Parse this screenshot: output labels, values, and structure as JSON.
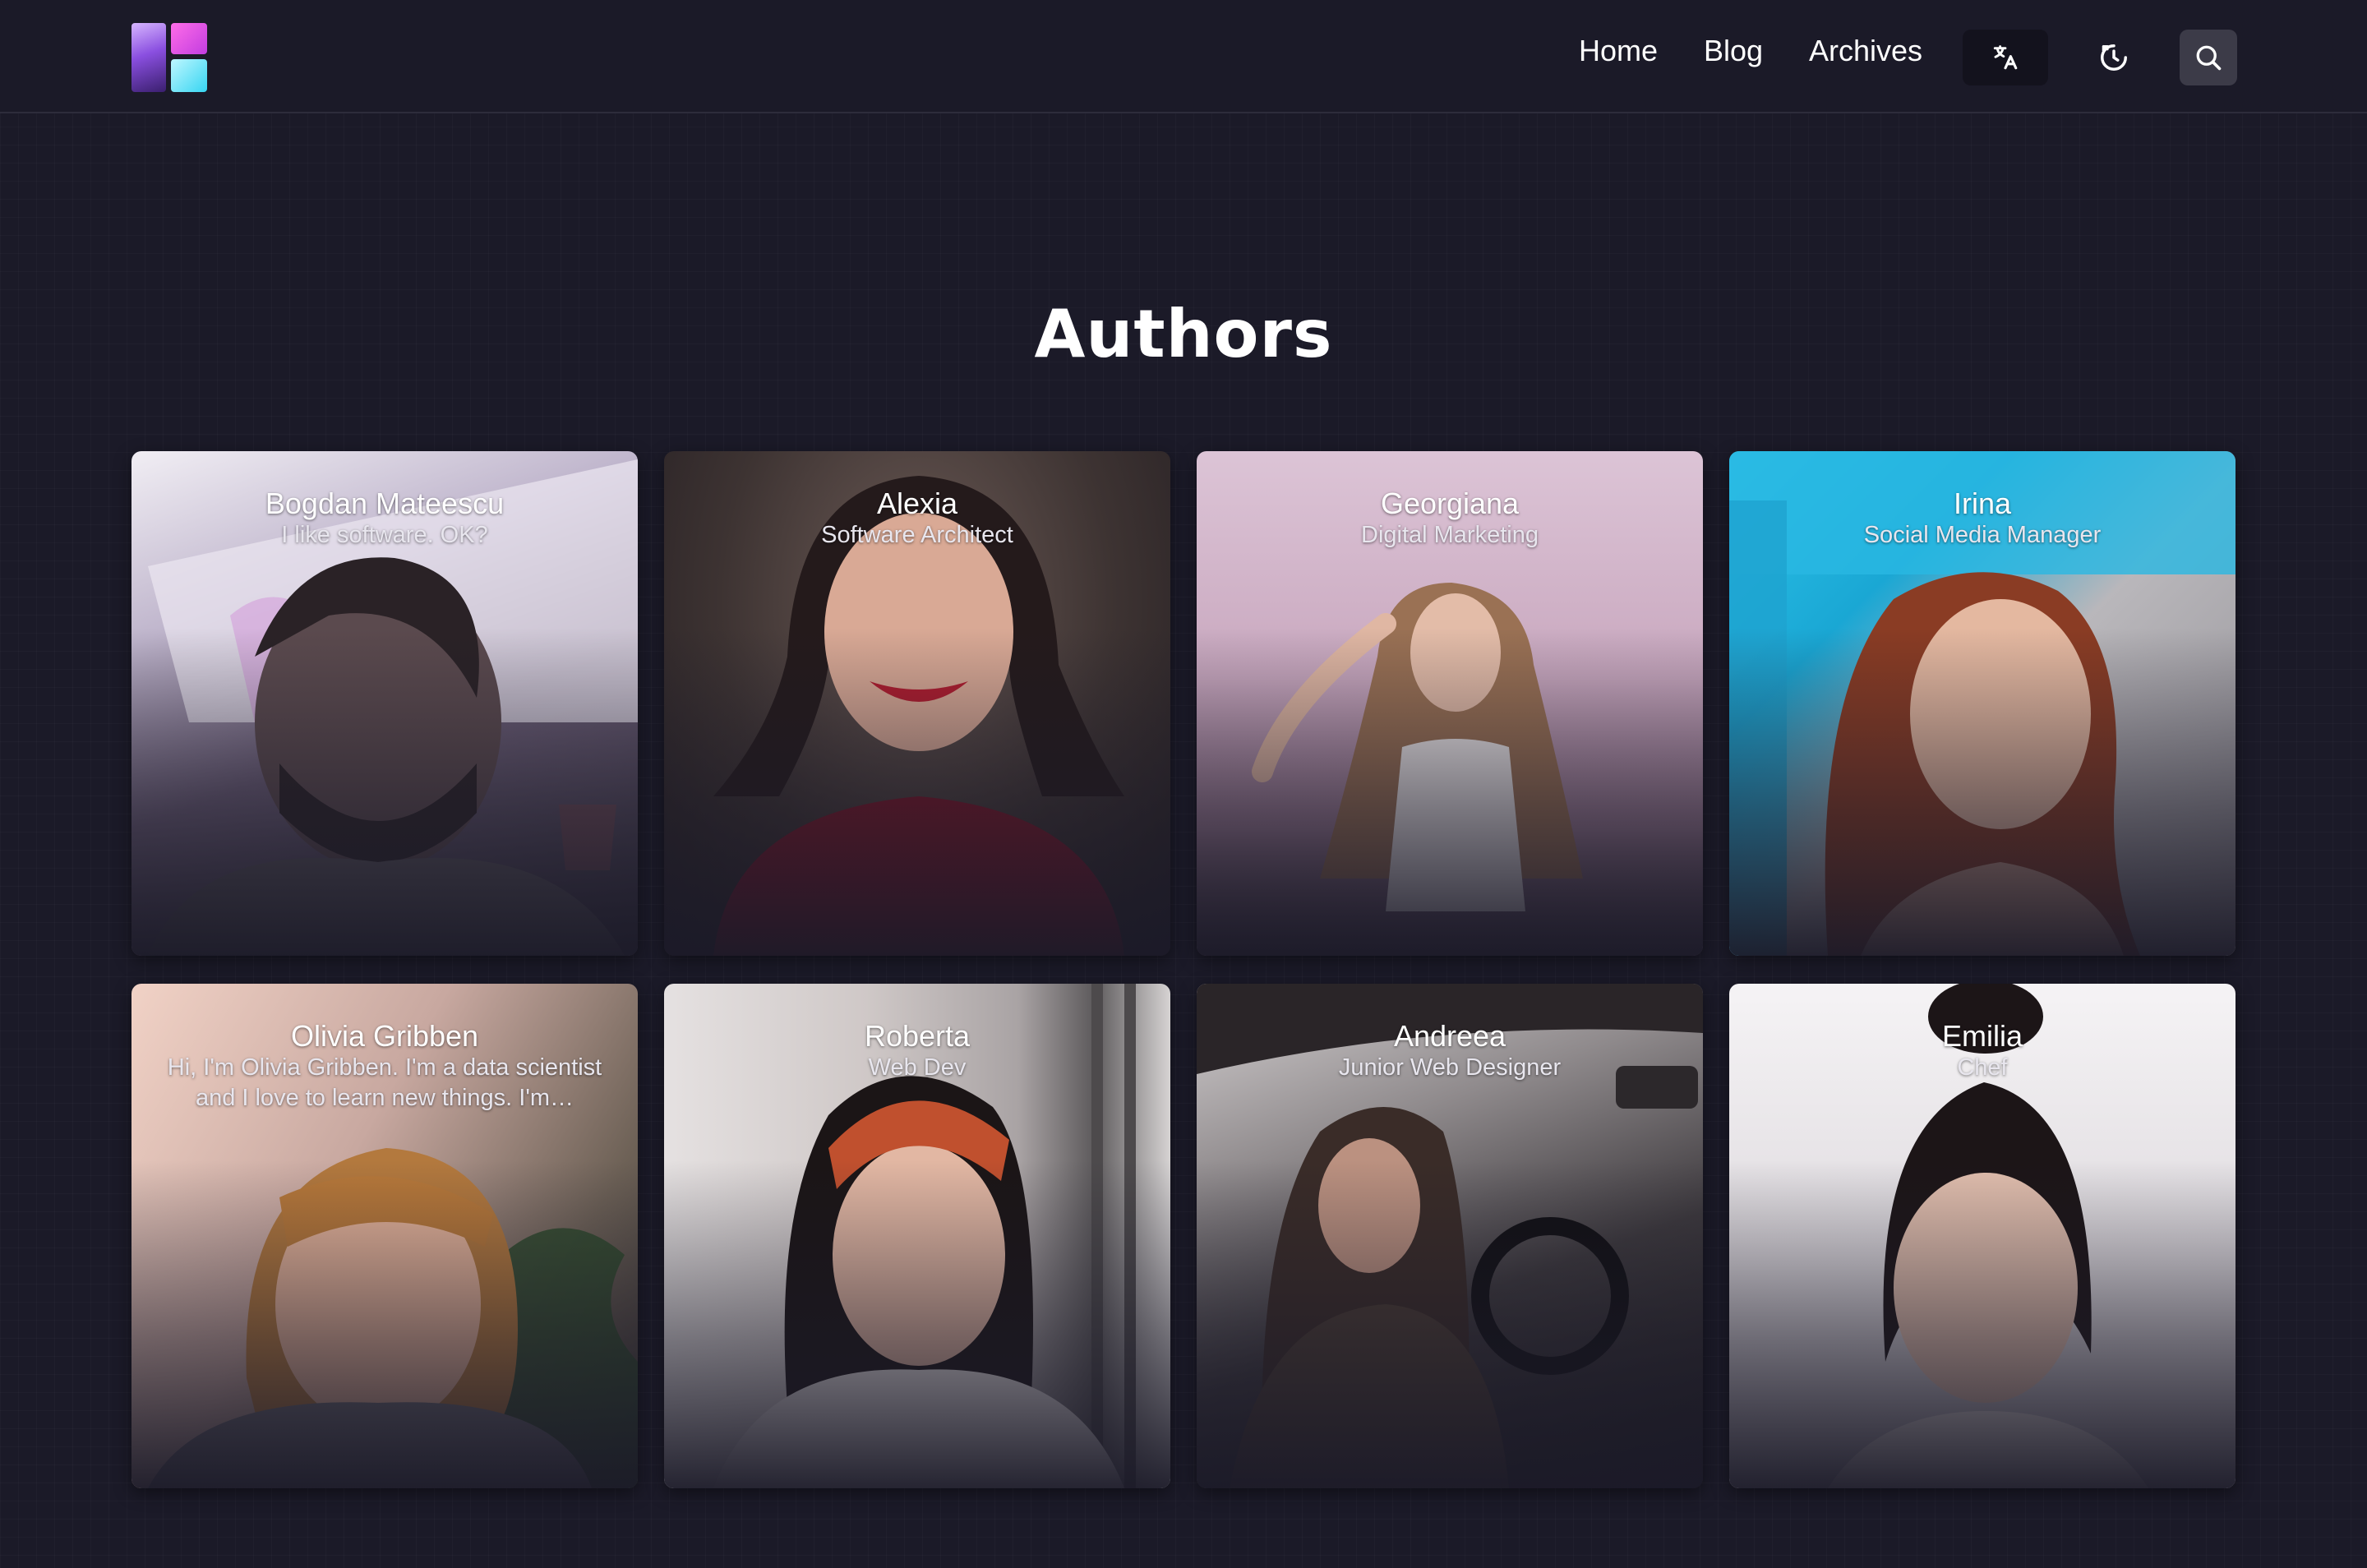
{
  "nav": {
    "home": "Home",
    "blog": "Blog",
    "archives": "Archives"
  },
  "icons": {
    "language": "translate-icon",
    "theme": "theme-toggle-icon",
    "search": "search-icon"
  },
  "page": {
    "title": "Authors"
  },
  "authors": [
    {
      "name": "Bogdan Mateescu",
      "role": "I like software. OK?"
    },
    {
      "name": "Alexia",
      "role": "Software Architect"
    },
    {
      "name": "Georgiana",
      "role": "Digital Marketing"
    },
    {
      "name": "Irina",
      "role": "Social Media Manager"
    },
    {
      "name": "Olivia Gribben",
      "role": "Hi, I'm Olivia Gribben. I'm a data scientist and I love to learn new things. I'm…"
    },
    {
      "name": "Roberta",
      "role": "Web Dev"
    },
    {
      "name": "Andreea",
      "role": "Junior Web Designer"
    },
    {
      "name": "Emilia",
      "role": "Chef"
    }
  ],
  "colors": {
    "background": "#1b1a28",
    "header_border": "#2d2c3b",
    "search_button": "#3c3b48",
    "language_button": "#13121d"
  }
}
